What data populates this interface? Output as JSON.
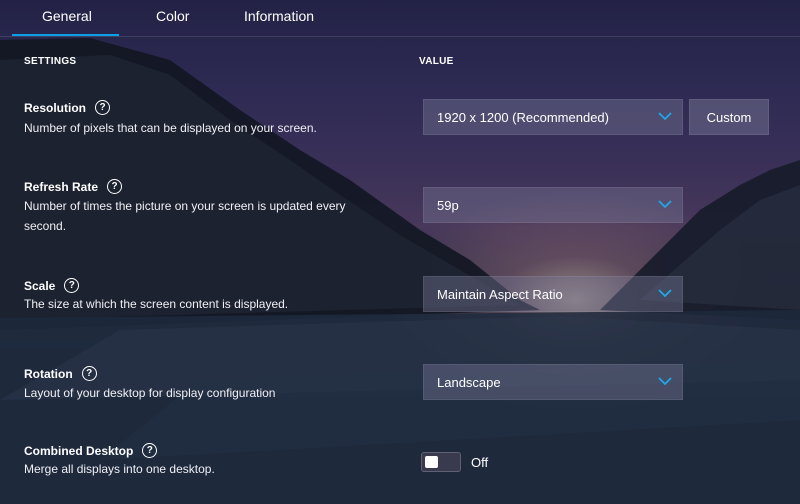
{
  "tabs": [
    {
      "label": "General",
      "active": true
    },
    {
      "label": "Color",
      "active": false
    },
    {
      "label": "Information",
      "active": false
    }
  ],
  "columns": {
    "settings": "SETTINGS",
    "value": "VALUE"
  },
  "settings": {
    "resolution": {
      "title": "Resolution",
      "description": "Number of pixels that can be displayed on your screen.",
      "value": "1920 x 1200 (Recommended)",
      "custom_label": "Custom"
    },
    "refresh_rate": {
      "title": "Refresh Rate",
      "description": "Number of times the picture on your screen is updated every second.",
      "value": "59p"
    },
    "scale": {
      "title": "Scale",
      "description": "The size at which the screen content is displayed.",
      "value": "Maintain Aspect Ratio"
    },
    "rotation": {
      "title": "Rotation",
      "description": "Layout of your desktop for display configuration",
      "value": "Landscape"
    },
    "combined_desktop": {
      "title": "Combined Desktop",
      "description": "Merge all displays into one desktop.",
      "toggle_state": "Off"
    }
  },
  "help_glyph": "?",
  "colors": {
    "accent": "#0aa0e8",
    "chevron": "#1fa7e8"
  }
}
